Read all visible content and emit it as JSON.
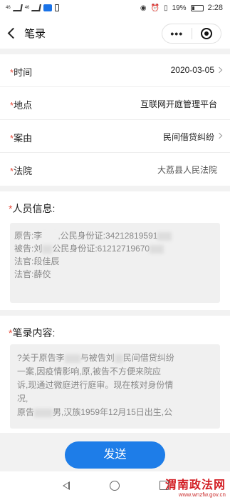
{
  "status_bar": {
    "signal_left": "46",
    "signal_mid": "46",
    "battery_percent": "19%",
    "time": "2:28"
  },
  "navbar": {
    "title": "笔录",
    "more_label": "•••"
  },
  "form": {
    "rows": [
      {
        "label": "时间",
        "value": "2020-03-05",
        "chevron": true
      },
      {
        "label": "地点",
        "value": "互联网开庭管理平台",
        "chevron": false
      },
      {
        "label": "案由",
        "value": "民间借贷纠纷",
        "chevron": true
      },
      {
        "label": "法院",
        "value": "大荔县人民法院",
        "chevron": false
      }
    ],
    "required_mark": "*"
  },
  "personnel": {
    "title": "人员信息:",
    "lines": [
      {
        "role": "原告:李",
        "rest": ",公民身份证:34212819591",
        "tail": "1"
      },
      {
        "role": "被告:刘",
        "rest": "公民身份证:61212719670",
        "tail": ""
      },
      {
        "role": "法官:段佳辰",
        "rest": "",
        "tail": ""
      },
      {
        "role": "法官:薛佼",
        "rest": "",
        "tail": ""
      }
    ]
  },
  "record": {
    "title": "笔录内容:",
    "lines": [
      "?关于原告李",
      "与被告刘",
      "民间借贷纠纷",
      "一案,因疫情影响,原,被告不方便来院应",
      "诉,现通过微庭进行庭审。现在核对身份情",
      "况,",
      "原告",
      "男,汉族1959年12月15日出生,公"
    ]
  },
  "send_button": {
    "label": "发送"
  },
  "watermark": {
    "name": "渭南政法网",
    "url": "www.wnzfw.gov.cn"
  },
  "colors": {
    "accent": "#1e7de8",
    "required": "#e74c3c",
    "watermark": "#d31f25"
  }
}
